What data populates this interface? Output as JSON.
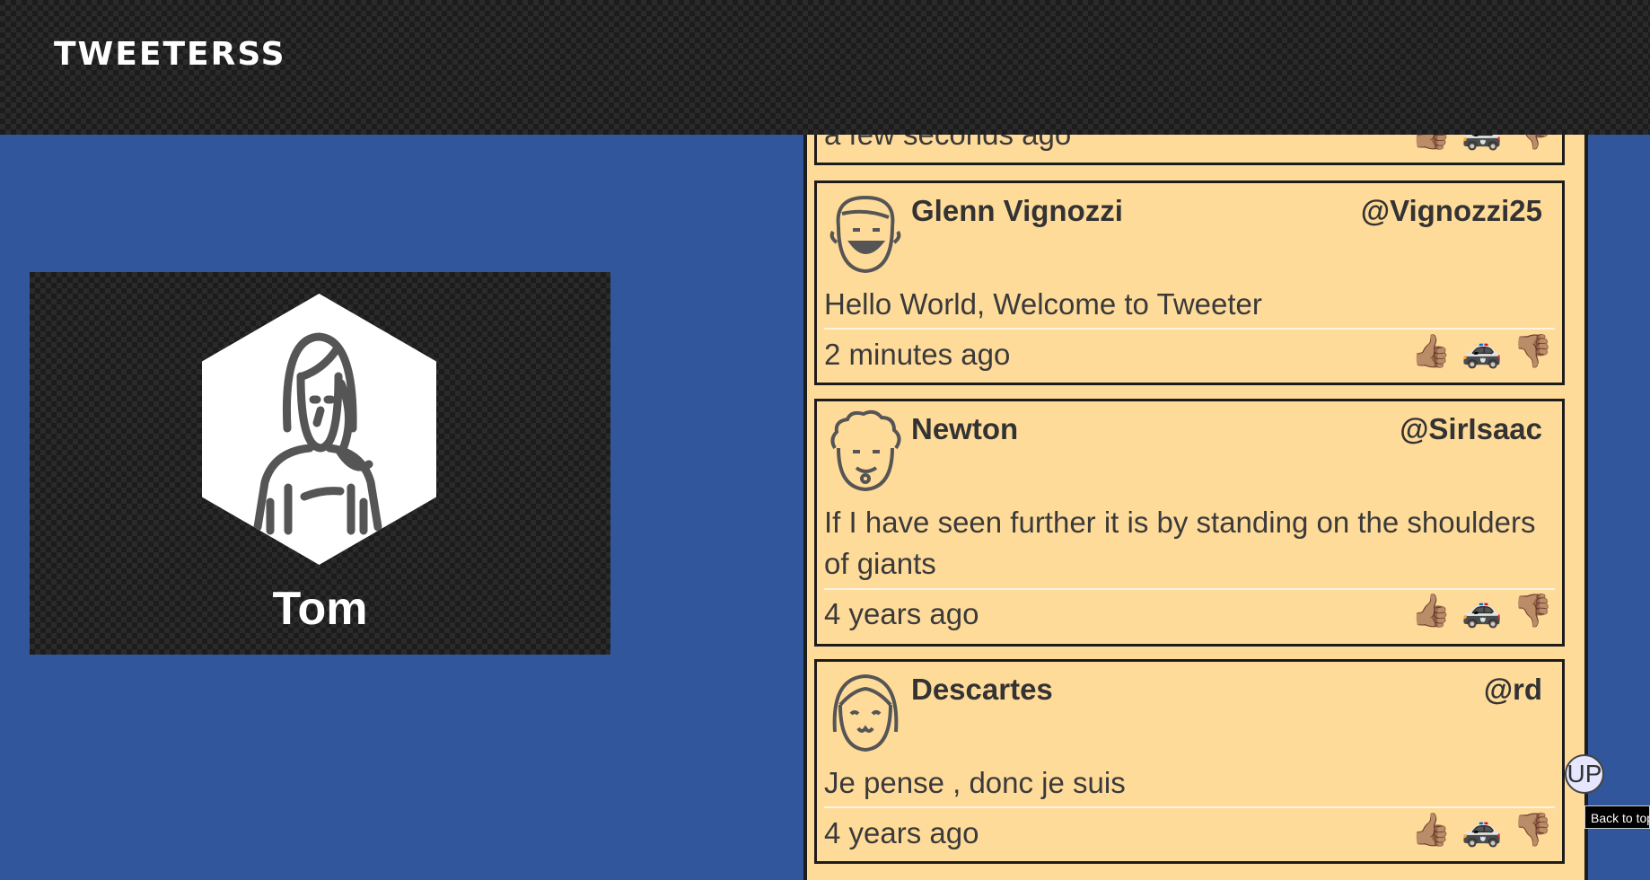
{
  "header": {
    "logo": "TWEETERSS"
  },
  "profile": {
    "name": "Tom"
  },
  "tweets": [
    {
      "name": "",
      "handle": "",
      "text": "",
      "time": "a few seconds ago"
    },
    {
      "name": "Glenn Vignozzi",
      "handle": "@Vignozzi25",
      "text": "Hello World, Welcome to Tweeter",
      "time": "2 minutes ago"
    },
    {
      "name": "Newton",
      "handle": "@SirIsaac",
      "text": "If I have seen further it is by standing on the shoulders of giants",
      "time": "4 years ago"
    },
    {
      "name": "Descartes",
      "handle": "@rd",
      "text": "Je pense , donc je suis",
      "time": "4 years ago"
    }
  ],
  "actions": {
    "like": "👍🏽",
    "report": "🚓",
    "dislike": "👎🏽"
  },
  "back_to_top": {
    "label": "UP",
    "tooltip": "Back to top"
  },
  "colors": {
    "page_bg": "#31569c",
    "tweet_bg": "#ffdb9a",
    "header_bg": "#1c1c1c"
  }
}
